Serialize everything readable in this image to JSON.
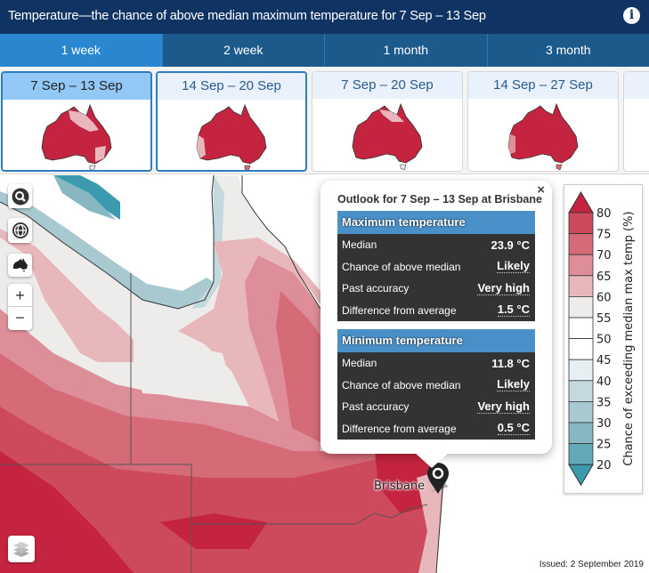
{
  "header": {
    "title": "Temperature—the chance of above median maximum temperature for 7 Sep – 13 Sep",
    "info_icon": "info-icon"
  },
  "tabs": [
    {
      "label": "1 week",
      "active": true
    },
    {
      "label": "2 week",
      "active": false
    },
    {
      "label": "1 month",
      "active": false
    },
    {
      "label": "3 month",
      "active": false
    }
  ],
  "thumbnails": [
    {
      "label": "7 Sep – 13 Sep",
      "state": "active"
    },
    {
      "label": "14 Sep – 20 Sep",
      "state": "selected"
    },
    {
      "label": "7 Sep – 20 Sep",
      "state": "normal"
    },
    {
      "label": "14 Sep – 27 Sep",
      "state": "normal"
    }
  ],
  "map_controls": {
    "search": "search-icon",
    "globe": "globe-icon",
    "australia": "australia-icon",
    "zoom_in": "+",
    "zoom_out": "−",
    "layers": "layers-icon"
  },
  "popup": {
    "title": "Outlook for 7 Sep – 13 Sep at Brisbane",
    "close": "×",
    "max": {
      "heading": "Maximum temperature",
      "rows": [
        {
          "label": "Median",
          "value": "23.9 °C"
        },
        {
          "label": "Chance of above median",
          "value": "Likely"
        },
        {
          "label": "Past accuracy",
          "value": "Very high"
        },
        {
          "label": "Difference from average",
          "value": "1.5 °C"
        }
      ]
    },
    "min": {
      "heading": "Minimum temperature",
      "rows": [
        {
          "label": "Median",
          "value": "11.8 °C"
        },
        {
          "label": "Chance of above median",
          "value": "Likely"
        },
        {
          "label": "Past accuracy",
          "value": "Very high"
        },
        {
          "label": "Difference from average",
          "value": "0.5 °C"
        }
      ]
    }
  },
  "marker": {
    "label": "Brisbane"
  },
  "legend": {
    "title": "Chance of exceeding median max temp (%)",
    "ticks": [
      "80",
      "75",
      "70",
      "65",
      "60",
      "55",
      "50",
      "45",
      "40",
      "35",
      "30",
      "25",
      "20"
    ],
    "colors": [
      "#c4243f",
      "#cd4a5c",
      "#d66b78",
      "#de8e98",
      "#e8b7bc",
      "#eeeceb",
      "#ffffff",
      "#ffffff",
      "#e7eff2",
      "#c4d9de",
      "#a7c9cf",
      "#87b8c2",
      "#63a9b8",
      "#3b9aad"
    ]
  },
  "issued": "Issued: 2 September 2019"
}
